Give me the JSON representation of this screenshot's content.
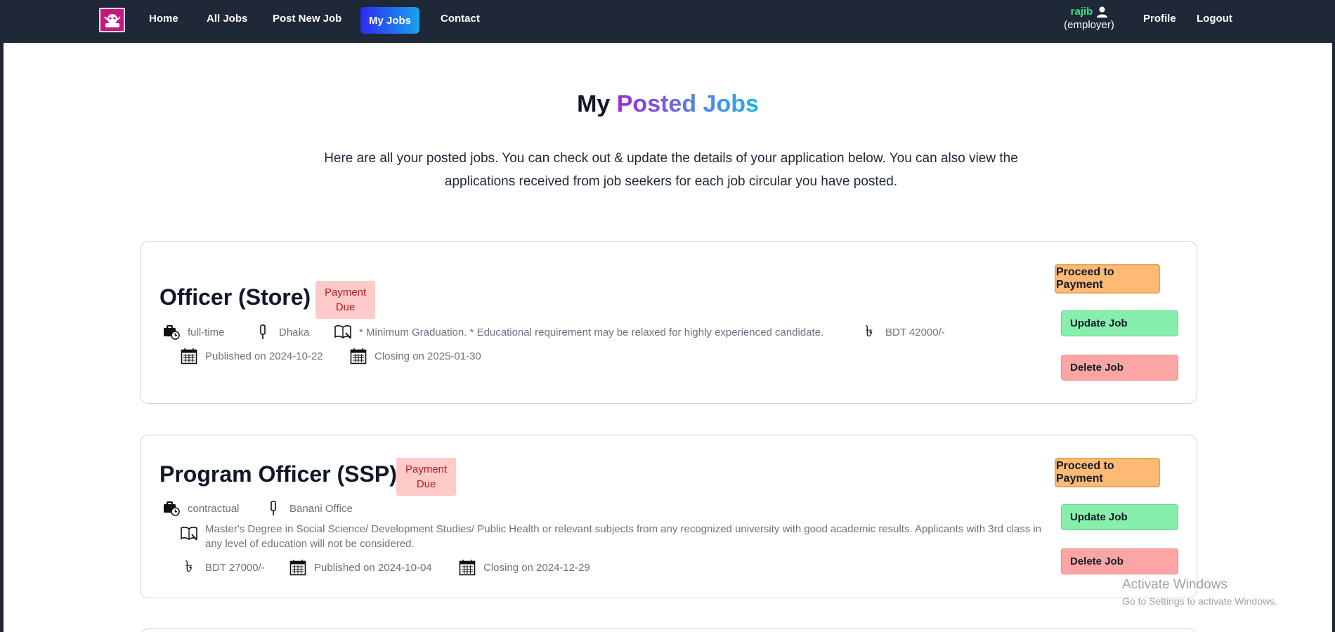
{
  "nav": {
    "links": [
      "Home",
      "All Jobs",
      "Post New Job",
      "My Jobs",
      "Contact"
    ],
    "user": {
      "name": "rajib",
      "role": "(employer)"
    },
    "profile": "Profile",
    "logout": "Logout",
    "active_gradient": [
      "#2b2bf0",
      "#1aa3f0"
    ]
  },
  "page": {
    "title_part1": "My",
    "title_part2": "Posted Jobs",
    "intro": "Here are all your posted jobs. You can check out & update the details of your application below. You can also view the applications received from job seekers for each job circular you have posted."
  },
  "jobs": [
    {
      "title": "Officer (Store)",
      "badge": [
        "Payment",
        "Due"
      ],
      "type": "full-time",
      "location": "Dhaka",
      "requirement": "* Minimum Graduation. * Educational requirement may be relaxed for highly experienced candidate.",
      "salary": "BDT 42000/-",
      "published": "Published on 2024-10-22",
      "closing": "Closing on 2025-01-30",
      "buttons": {
        "pay": "Proceed to Payment",
        "update": "Update Job",
        "delete": "Delete Job"
      }
    },
    {
      "title": "Program Officer (SSP)",
      "badge": [
        "Payment",
        "Due"
      ],
      "type": "contractual",
      "location": "Banani Office",
      "requirement": "Master's Degree in Social Science/ Development Studies/ Public Health or relevant subjects from any recognized university with good academic results. Applicants with 3rd class in any level of education will not be considered.",
      "salary": "BDT 27000/-",
      "published": "Published on 2024-10-04",
      "closing": "Closing on 2024-12-29",
      "buttons": {
        "pay": "Proceed to Payment",
        "update": "Update Job",
        "delete": "Delete Job"
      }
    }
  ],
  "watermark": {
    "line1": "Activate Windows",
    "line2": "Go to Settings to activate Windows."
  },
  "colors": {
    "navbar": "#1e2836",
    "badge_bg": "#fecaca",
    "pay": "#fdba74",
    "update": "#86efac",
    "delete": "#fca5a5",
    "username": "#35e08b"
  }
}
